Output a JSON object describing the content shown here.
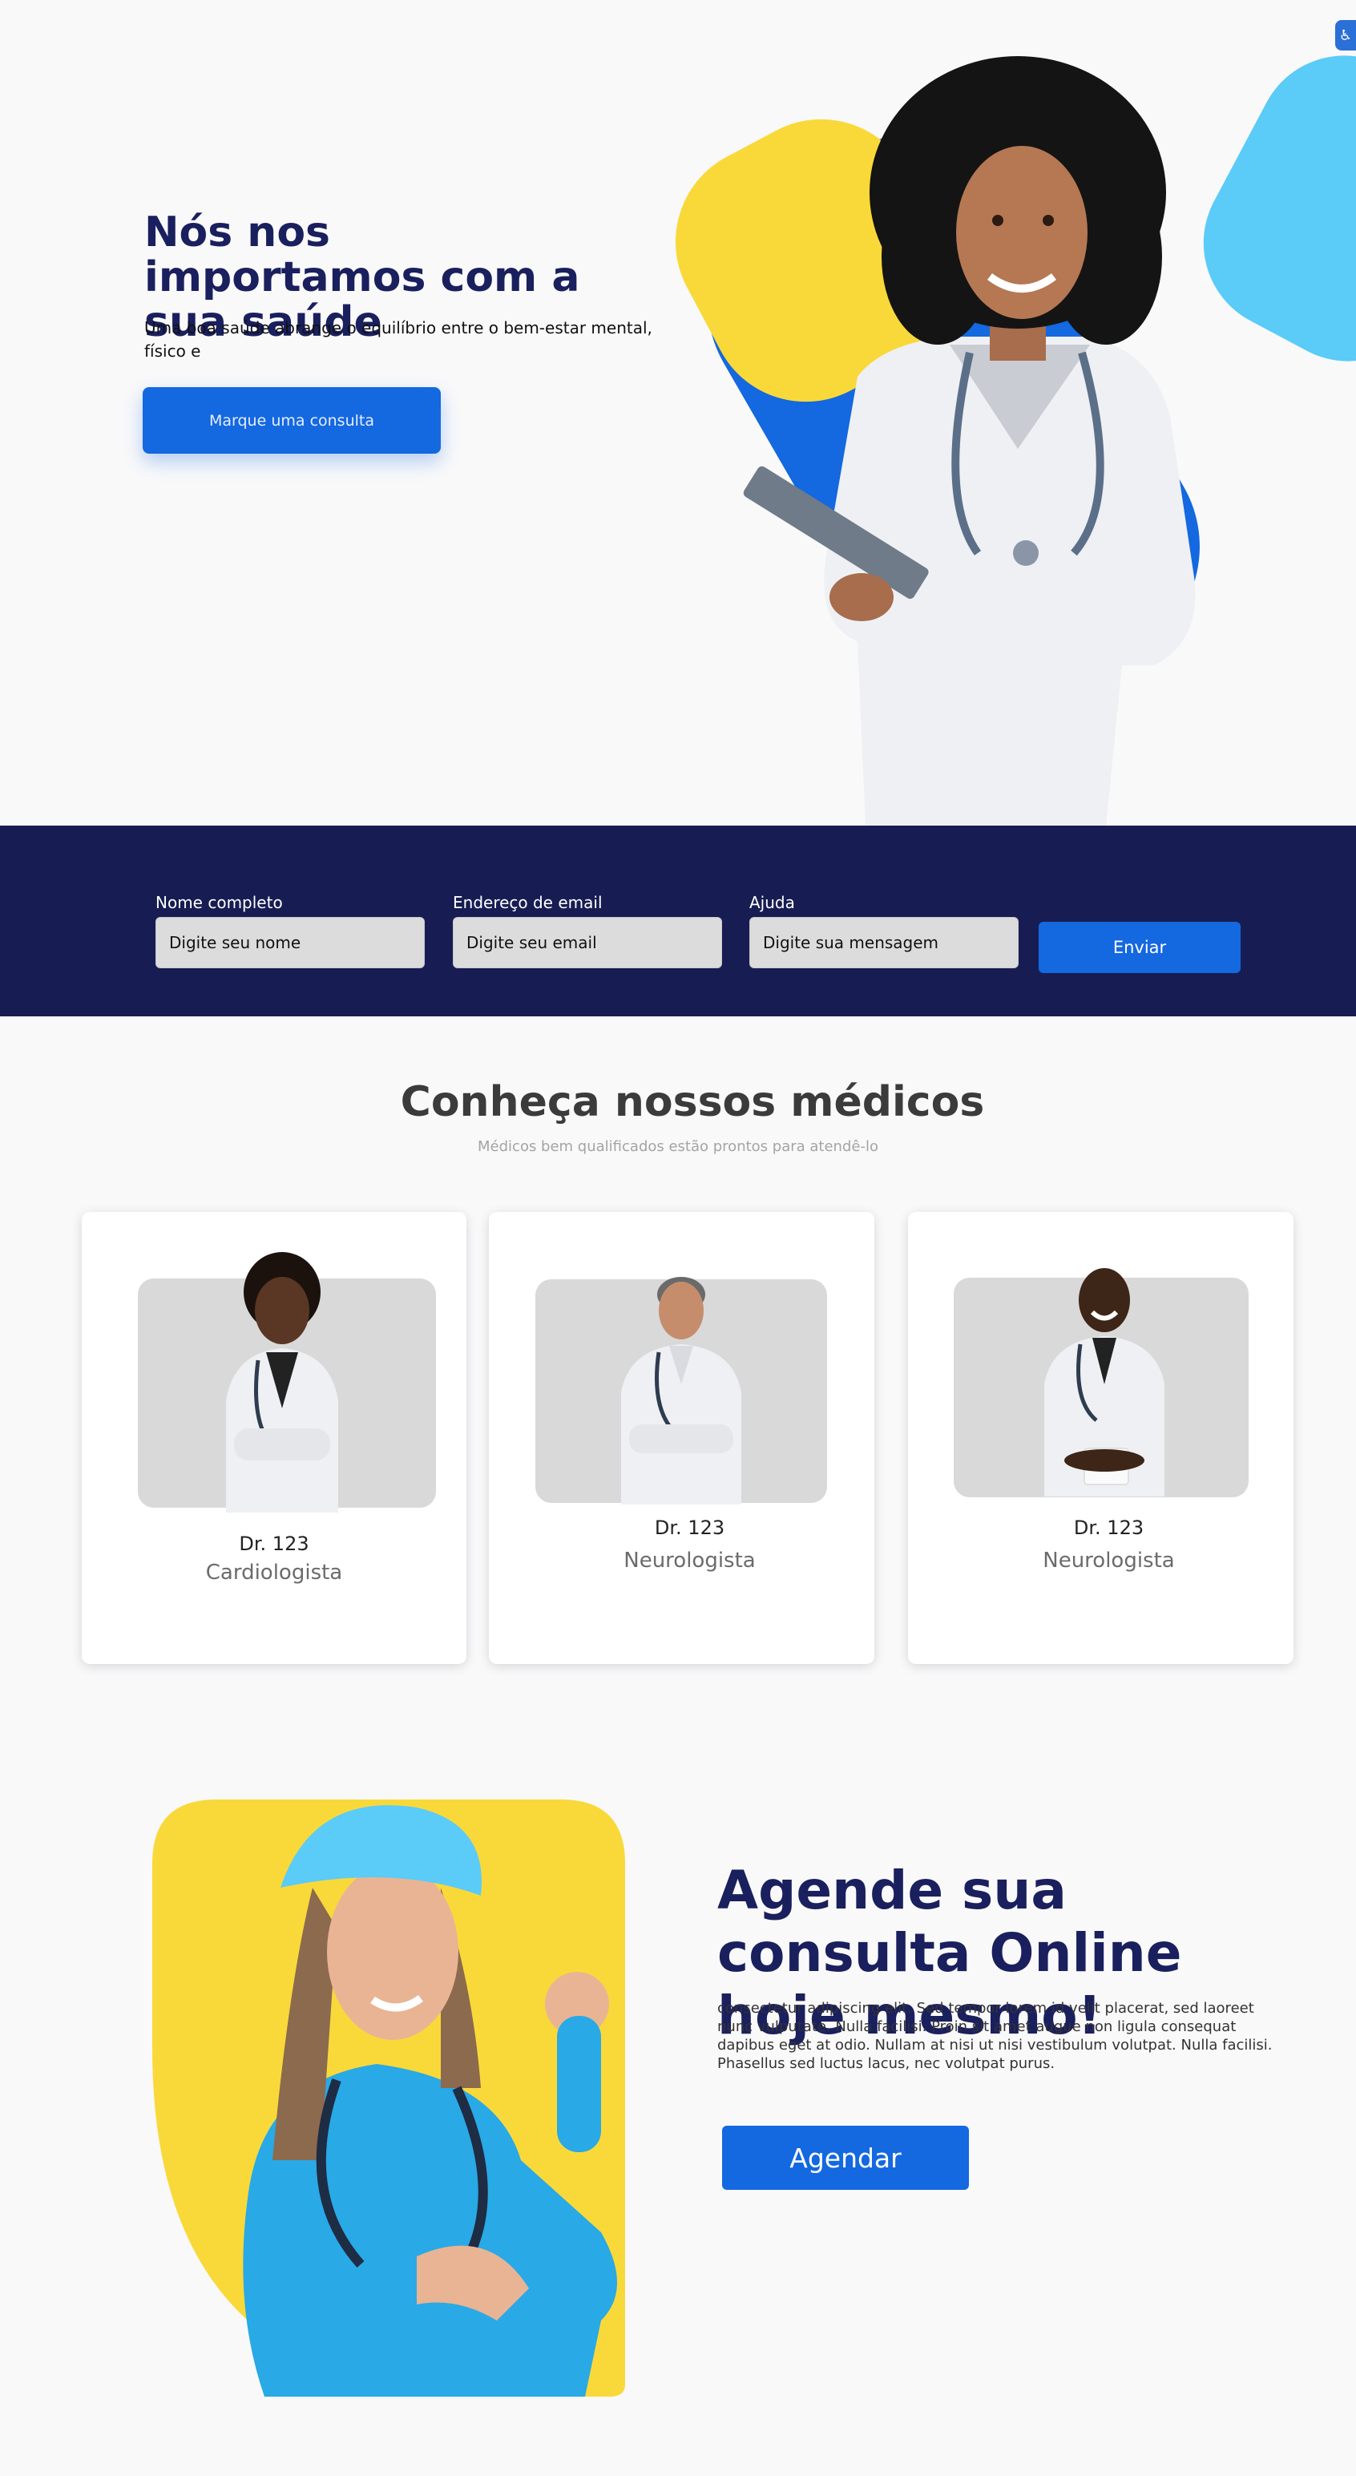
{
  "hero": {
    "title": "Nós nos importamos com a sua saúde",
    "subtitle": "Uma boa saúde abrange o equilíbrio entre o bem-estar mental, físico e",
    "cta_label": "Marque uma consulta"
  },
  "contact_form": {
    "fields": [
      {
        "label": "Nome completo",
        "placeholder": "Digite seu nome"
      },
      {
        "label": "Endereço de email",
        "placeholder": "Digite seu email"
      },
      {
        "label": "Ajuda",
        "placeholder": "Digite sua mensagem"
      }
    ],
    "submit_label": "Enviar"
  },
  "doctors": {
    "title": "Conheça nossos médicos",
    "subtitle": "Médicos bem qualificados estão prontos para atendê-lo",
    "cards": [
      {
        "name": "Dr. 123",
        "specialty": "Cardiologista"
      },
      {
        "name": "Dr. 123",
        "specialty": "Neurologista"
      },
      {
        "name": "Dr. 123",
        "specialty": "Neurologista"
      }
    ]
  },
  "booking": {
    "title": "Agende sua consulta Online hoje mesmo!",
    "text": "consectetur adipiscing elit. Sed tempor lorem id velit placerat, sed laoreet nunc vulputate. Nulla facilisi. Proin sit amet augue non ligula consequat dapibus eget at odio. Nullam at nisi ut nisi vestibulum volutpat. Nulla facilisi. Phasellus sed luctus lacus, nec volutpat purus.",
    "cta_label": "Agendar"
  },
  "colors": {
    "navy": "#1a1f5e",
    "primary_blue": "#1468e0",
    "form_band": "#171d52",
    "yellow": "#f9d93a",
    "sky_blue": "#5bcbf8"
  },
  "icons": [
    "accessibility-icon"
  ]
}
